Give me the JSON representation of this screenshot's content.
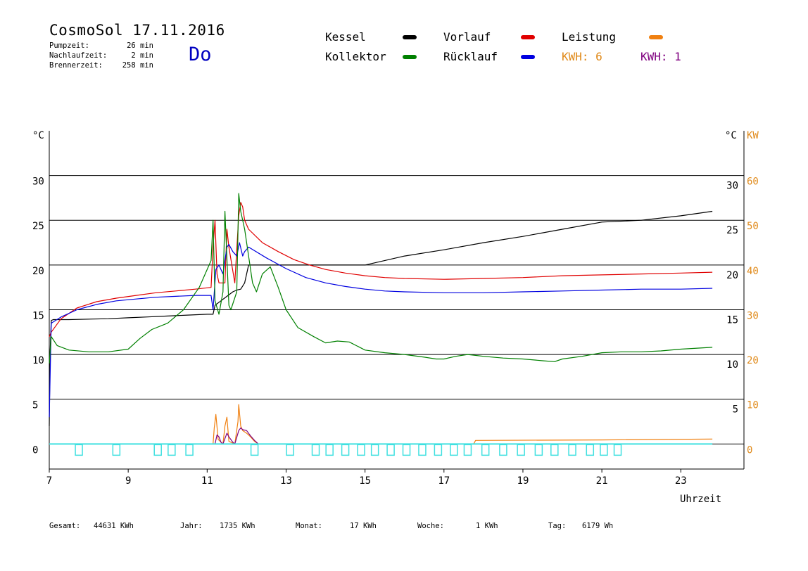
{
  "header": {
    "title": "CosmoSol 17.11.2016",
    "day": "Do",
    "stats": [
      {
        "label": "Pumpzeit:",
        "value": "26 min"
      },
      {
        "label": "Nachlaufzeit:",
        "value": "2 min"
      },
      {
        "label": "Brennerzeit:",
        "value": "258 min"
      }
    ]
  },
  "legend": {
    "items": [
      {
        "label": "Kessel",
        "color": "#000000"
      },
      {
        "label": "Vorlauf",
        "color": "#e00000"
      },
      {
        "label": "Leistung",
        "color": "#f08010"
      },
      {
        "label": "Kollektor",
        "color": "#008000"
      },
      {
        "label": "Rücklauf",
        "color": "#0000e0"
      }
    ],
    "kwh": [
      {
        "label": "KWH: 6",
        "color": "#e08a1a"
      },
      {
        "label": "KWH: 1",
        "color": "#800080"
      }
    ]
  },
  "footer": [
    {
      "label": "Gesamt:",
      "value": "44631 KWh"
    },
    {
      "label": "Jahr:",
      "value": "1735 KWh"
    },
    {
      "label": "Monat:",
      "value": "17 KWh"
    },
    {
      "label": "Woche:",
      "value": "1 KWh"
    },
    {
      "label": "Tag:",
      "value": "6179 Wh"
    }
  ],
  "chart_data": {
    "type": "line",
    "xlabel": "Uhrzeit",
    "xlim": [
      7,
      24.6
    ],
    "xticks": [
      7,
      9,
      11,
      13,
      15,
      17,
      19,
      21,
      23
    ],
    "ylabel_left": "°C",
    "ylabel_right": "°C",
    "ylabel_right2": "KW",
    "ylim": [
      -2.8,
      35
    ],
    "yticks_left": [
      0,
      5,
      10,
      15,
      20,
      25,
      30
    ],
    "yticks_right": [
      5,
      10,
      15,
      20,
      25,
      30
    ],
    "yticks_kw": [
      0,
      10,
      20,
      30,
      40,
      50,
      60
    ],
    "grid_y": [
      0,
      5,
      10,
      15,
      20,
      25,
      30
    ],
    "series": [
      {
        "name": "Kessel",
        "color": "#000000",
        "x": [
          7.0,
          7.02,
          7.05,
          7.1,
          7.5,
          8.5,
          9.0,
          9.5,
          10.0,
          10.5,
          11.0,
          11.15,
          11.2,
          11.35,
          11.5,
          11.65,
          11.75,
          11.85,
          11.95,
          12.05,
          12.5,
          15.0,
          16.0,
          17.0,
          18.0,
          19.0,
          20.0,
          21.0,
          22.0,
          23.0,
          23.8
        ],
        "y": [
          2,
          10,
          13.8,
          13.9,
          13.9,
          14.0,
          14.1,
          14.2,
          14.3,
          14.4,
          14.5,
          14.5,
          15.5,
          16.0,
          16.5,
          17.0,
          17.2,
          17.3,
          18.0,
          20.0,
          20.0,
          20.0,
          21.0,
          21.7,
          22.5,
          23.2,
          24.0,
          24.8,
          25.0,
          25.5,
          26.0
        ]
      },
      {
        "name": "Vorlauf",
        "color": "#e00000",
        "x": [
          7.0,
          7.05,
          7.3,
          7.7,
          8.2,
          8.7,
          9.2,
          9.7,
          10.2,
          10.7,
          11.1,
          11.15,
          11.2,
          11.25,
          11.3,
          11.45,
          11.5,
          11.55,
          11.7,
          11.8,
          11.85,
          11.9,
          11.95,
          12.05,
          12.4,
          12.8,
          13.2,
          13.6,
          14.0,
          14.5,
          15.0,
          15.5,
          16.0,
          17.0,
          18.0,
          19.0,
          20.0,
          21.0,
          22.0,
          23.0,
          23.8
        ],
        "y": [
          12.0,
          12.5,
          14.0,
          15.2,
          15.9,
          16.3,
          16.6,
          16.9,
          17.1,
          17.3,
          17.5,
          22.0,
          25.0,
          19.0,
          18.0,
          18.0,
          24.0,
          22.0,
          18.0,
          25.5,
          27.0,
          26.5,
          25.0,
          24.0,
          22.5,
          21.5,
          20.6,
          20.0,
          19.5,
          19.1,
          18.8,
          18.6,
          18.5,
          18.4,
          18.5,
          18.6,
          18.8,
          18.9,
          19.0,
          19.1,
          19.2
        ]
      },
      {
        "name": "Rücklauf",
        "color": "#0000e0",
        "x": [
          7.0,
          7.05,
          7.3,
          7.7,
          8.2,
          8.7,
          9.2,
          9.7,
          10.2,
          10.7,
          11.1,
          11.15,
          11.22,
          11.3,
          11.4,
          11.5,
          11.55,
          11.65,
          11.75,
          11.82,
          11.9,
          11.95,
          12.05,
          12.5,
          13.0,
          13.5,
          14.0,
          14.5,
          15.0,
          15.5,
          16.0,
          17.0,
          18.0,
          19.0,
          20.0,
          21.0,
          22.0,
          23.0,
          23.8
        ],
        "y": [
          3,
          13.5,
          14.2,
          15.0,
          15.6,
          16.0,
          16.2,
          16.4,
          16.5,
          16.6,
          16.6,
          15.0,
          19.5,
          20.0,
          19.0,
          22.0,
          22.3,
          21.5,
          21.0,
          22.5,
          21.0,
          21.5,
          22.0,
          20.8,
          19.6,
          18.6,
          18.0,
          17.6,
          17.3,
          17.1,
          17.0,
          16.9,
          16.9,
          17.0,
          17.1,
          17.2,
          17.3,
          17.3,
          17.4
        ]
      },
      {
        "name": "Kollektor",
        "color": "#008000",
        "x": [
          7.0,
          7.05,
          7.2,
          7.5,
          8.0,
          8.5,
          9.0,
          9.3,
          9.6,
          10.0,
          10.4,
          10.8,
          11.0,
          11.1,
          11.15,
          11.2,
          11.3,
          11.4,
          11.45,
          11.55,
          11.6,
          11.75,
          11.8,
          11.85,
          11.95,
          12.05,
          12.15,
          12.25,
          12.4,
          12.6,
          12.8,
          13.0,
          13.3,
          13.7,
          14.0,
          14.3,
          14.6,
          15.0,
          15.5,
          16.0,
          16.5,
          16.8,
          17.0,
          17.3,
          17.6,
          18.0,
          18.5,
          19.0,
          19.5,
          19.8,
          20.0,
          20.5,
          21.0,
          21.5,
          22.0,
          22.5,
          23.0,
          23.8
        ],
        "y": [
          9.0,
          12.0,
          11.0,
          10.5,
          10.3,
          10.3,
          10.6,
          11.8,
          12.8,
          13.5,
          15.0,
          17.5,
          19.5,
          20.5,
          25.0,
          16.0,
          14.5,
          17.0,
          26.0,
          15.5,
          15.0,
          17.0,
          28.0,
          26.0,
          24.0,
          21.0,
          18.0,
          17.0,
          19.0,
          19.8,
          17.5,
          15.0,
          13.0,
          12.0,
          11.3,
          11.5,
          11.4,
          10.5,
          10.2,
          10.0,
          9.7,
          9.5,
          9.5,
          9.8,
          10.0,
          9.8,
          9.6,
          9.5,
          9.3,
          9.2,
          9.5,
          9.8,
          10.2,
          10.3,
          10.3,
          10.4,
          10.6,
          10.8
        ]
      },
      {
        "name": "Leistung",
        "color": "#f08010",
        "x": [
          7.0,
          11.15,
          11.18,
          11.22,
          11.28,
          11.4,
          11.45,
          11.5,
          11.55,
          11.7,
          11.78,
          11.8,
          11.85,
          11.9,
          12.0,
          12.1,
          12.2,
          12.3,
          17.75,
          17.8,
          21.0,
          23.8
        ],
        "y": [
          0,
          0,
          1.8,
          3.3,
          0.5,
          0,
          2.0,
          3.0,
          0.3,
          0,
          2.5,
          4.4,
          2.0,
          1.5,
          1.2,
          0.8,
          0.3,
          0,
          0,
          0.4,
          0.45,
          0.55
        ]
      },
      {
        "name": "Pumpe",
        "color": "#800080",
        "x": [
          7.0,
          11.2,
          11.25,
          11.3,
          11.35,
          11.4,
          11.45,
          11.5,
          11.55,
          11.6,
          11.65,
          11.7,
          11.8,
          11.85,
          11.9,
          12.0,
          12.1,
          12.2,
          12.3,
          23.8
        ],
        "y": [
          0,
          0,
          1.0,
          0.8,
          0.2,
          0,
          0.6,
          1.2,
          0.8,
          0.5,
          0.2,
          0,
          1.5,
          1.8,
          1.6,
          1.5,
          0.9,
          0.4,
          0,
          0
        ]
      }
    ],
    "pump_marks": [
      7.75,
      8.7,
      9.75,
      10.1,
      10.55,
      12.2,
      13.1,
      13.75,
      14.1,
      14.5,
      14.9,
      15.25,
      15.65,
      16.05,
      16.45,
      16.85,
      17.25,
      17.6,
      18.05,
      18.5,
      18.95,
      19.4,
      19.8,
      20.25,
      20.7,
      21.05,
      21.4
    ],
    "pump_baseline_color": "#40e0e0",
    "pump_level": 0
  }
}
